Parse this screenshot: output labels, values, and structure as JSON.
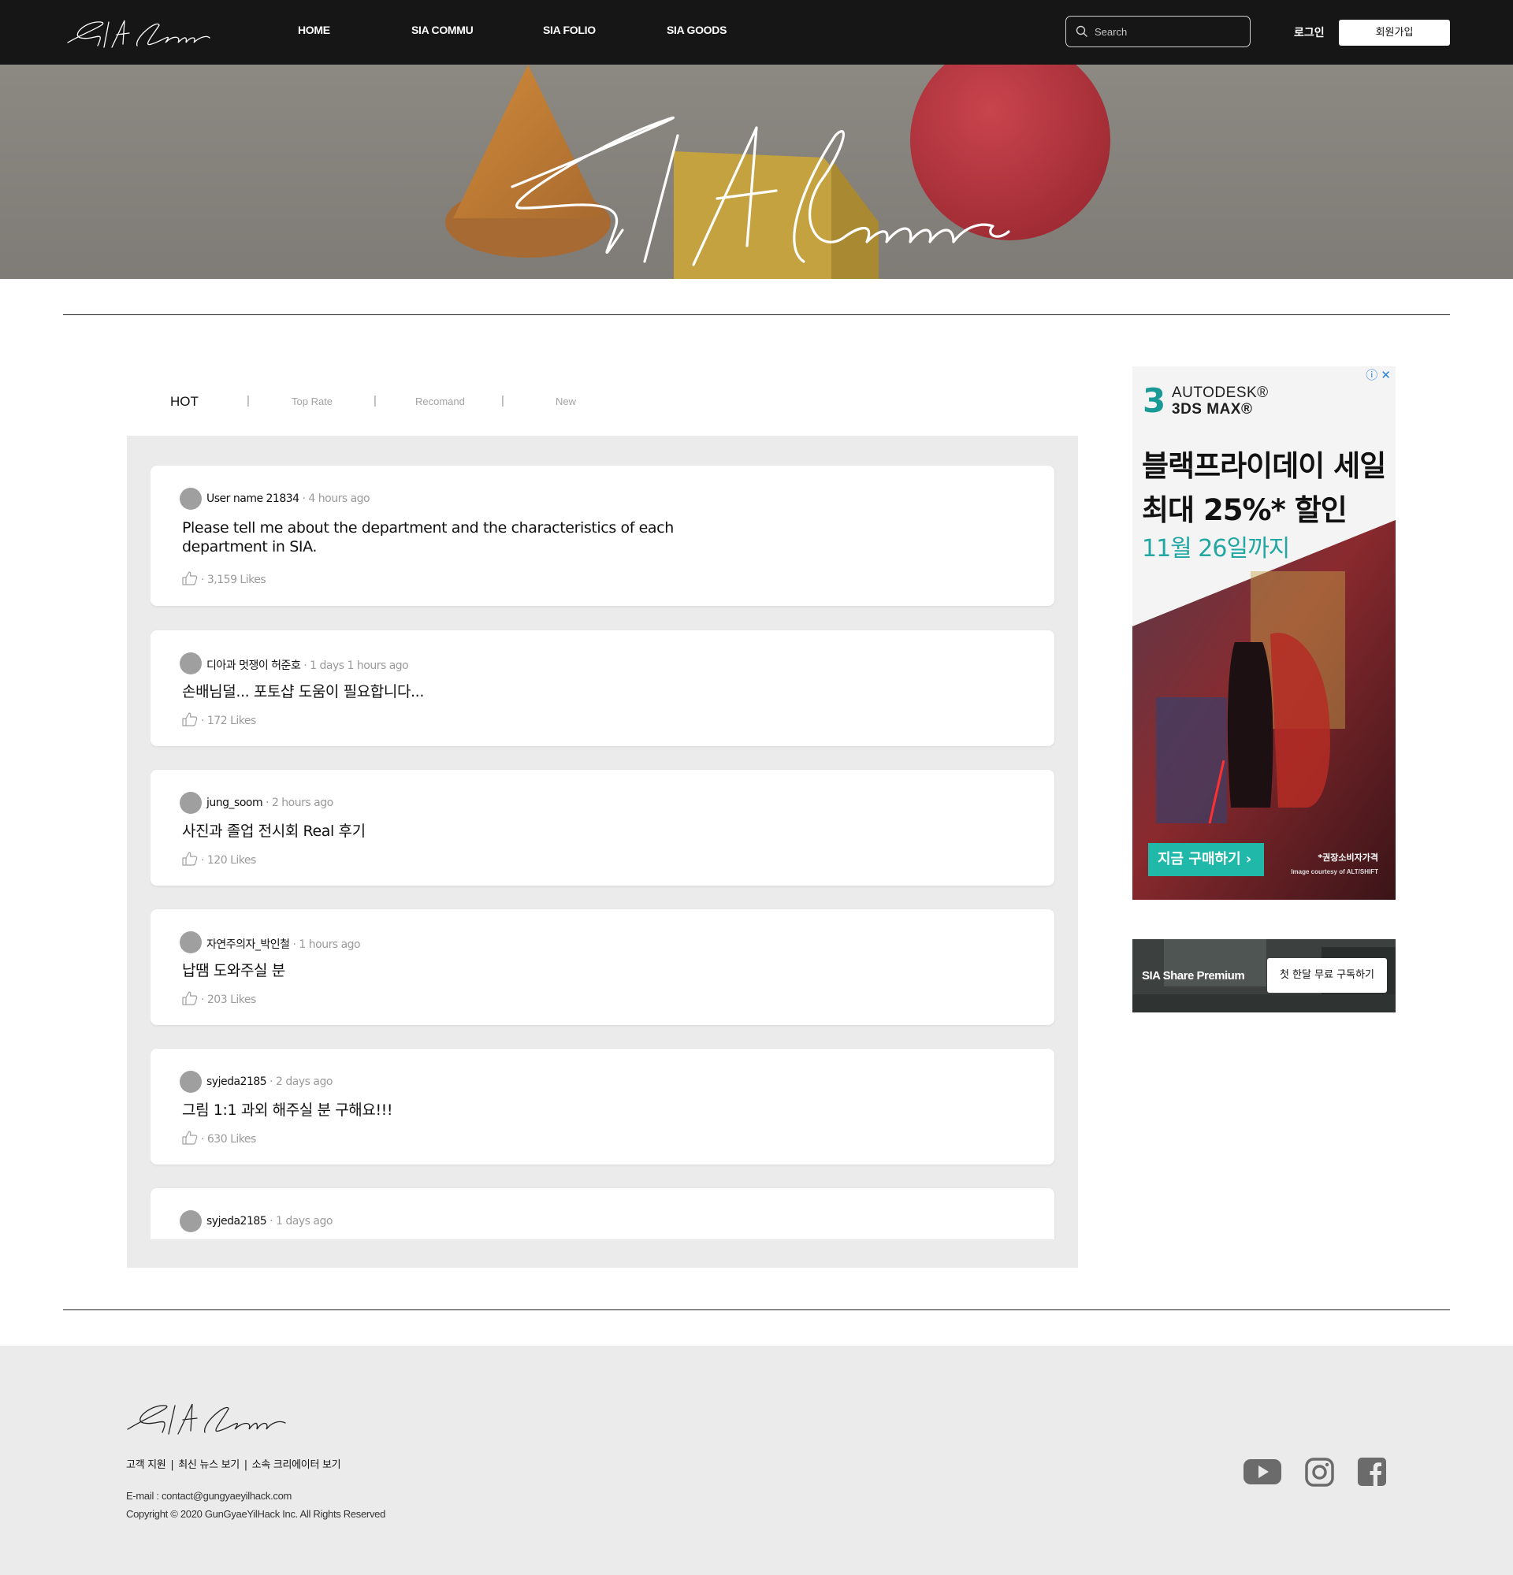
{
  "header": {
    "logo_text": "SIA Share",
    "nav": [
      "HOME",
      "SIA COMMU",
      "SIA FOLIO",
      "SIA GOODS"
    ],
    "search_placeholder": "Search",
    "login_label": "로그인",
    "signup_label": "회원가입"
  },
  "hero": {
    "title": "SIA Commu"
  },
  "tabs": {
    "items": [
      "HOT",
      "Top Rate",
      "Recomand",
      "New"
    ],
    "separator": "|",
    "active": "HOT"
  },
  "posts": [
    {
      "username": "User name 21834",
      "time": " · 4 hours ago",
      "title": "Please tell me about the department and the characteristics of each department in SIA.",
      "likes": "· 3,159 Likes"
    },
    {
      "username": "디아과 멋쟁이 허준호",
      "time": " · 1 days 1 hours ago",
      "title": "손배님덜... 포토샵 도움이 필요합니다...",
      "likes": "· 172 Likes"
    },
    {
      "username": "jung_soom",
      "time": " · 2 hours ago",
      "title": "사진과 졸업 전시회 Real 후기",
      "likes": "· 120 Likes"
    },
    {
      "username": "자연주의자_박인철",
      "time": " · 1 hours ago",
      "title": "납땜 도와주실 분",
      "likes": "· 203 Likes"
    },
    {
      "username": "syjeda2185",
      "time": " · 2 days ago",
      "title": "그림 1:1 과외 해주실 분 구해요!!!",
      "likes": "· 630 Likes"
    },
    {
      "username": "syjeda2185",
      "time": " · 1 days ago",
      "title": "",
      "likes": ""
    }
  ],
  "ad_autodesk": {
    "brand_line1": "AUTODESK®",
    "brand_line2": "3DS MAX®",
    "brand_number": "3",
    "headline1": "블랙프라이데이 세일",
    "headline2": "최대 25%* 할인",
    "headline3": "11월 26일까지",
    "cta": "지금 구매하기",
    "fine_print1": "*권장소비자가격",
    "fine_print2": "Image courtesy of ALT/SHIFT",
    "accent": "#1fb8a9"
  },
  "ad_premium": {
    "text": "SIA Share Premium",
    "cta": "첫 한달 무료 구독하기"
  },
  "footer": {
    "logo_text": "SIA Share",
    "links": [
      "고객 지원",
      "|",
      "최신 뉴스 보기",
      "|",
      "소속 크리에이터 보기"
    ],
    "email": "E-mail : contact@gungyaeyilhack.com",
    "copyright": "Copyright © 2020 GunGyaeYilHack Inc. All Rights Reserved",
    "social_icons": [
      "youtube-icon",
      "instagram-icon",
      "facebook-icon"
    ]
  },
  "colors": {
    "header_bg": "#161616",
    "feed_bg": "#ebebeb",
    "footer_bg": "#ebebeb"
  }
}
